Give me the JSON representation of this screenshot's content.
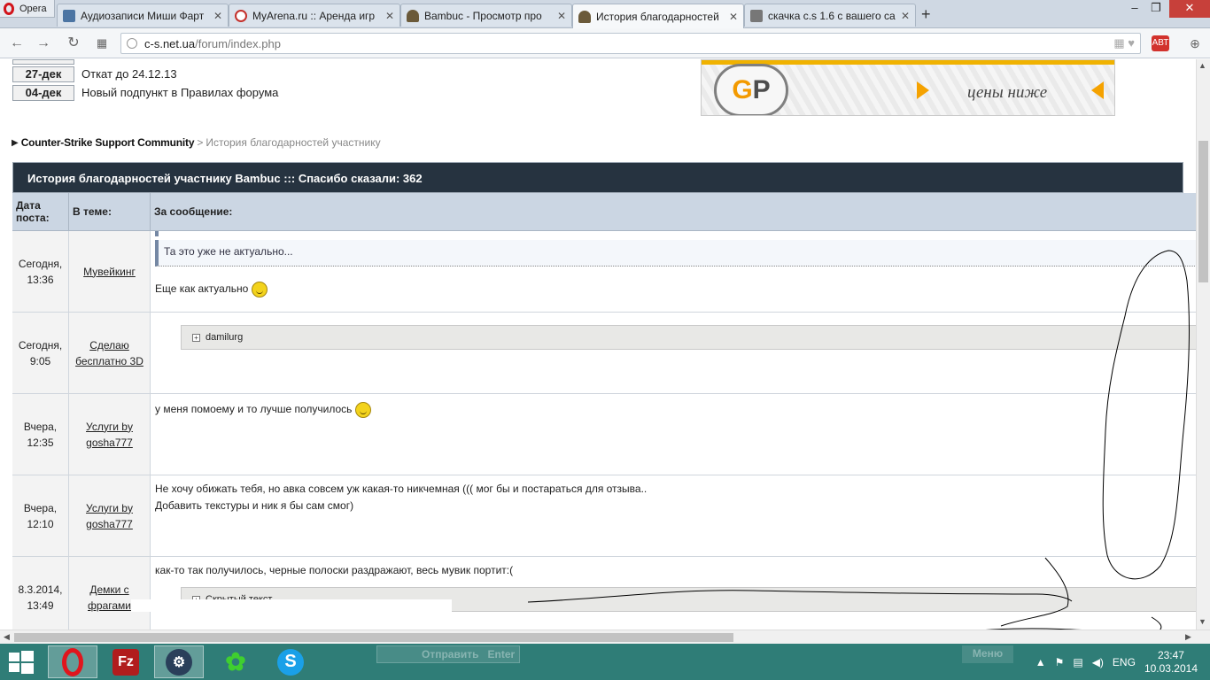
{
  "browser": {
    "menu_label": "Opera",
    "tabs": [
      {
        "title": "Аудиозаписи Миши Фарт",
        "icon": "vk-audio-icon",
        "color": "#4c75a3"
      },
      {
        "title": "MyArena.ru :: Аренда игр",
        "icon": "myarena-icon",
        "color": "#c4302b"
      },
      {
        "title": "Bambuc - Просмотр про",
        "icon": "cs-soldier-icon",
        "color": "#6b5a3a"
      },
      {
        "title": "История благодарностей",
        "icon": "cs-soldier-icon",
        "color": "#6b5a3a"
      },
      {
        "title": "скачка c.s 1.6 с вашего са",
        "icon": "gamepad-icon",
        "color": "#555555"
      }
    ],
    "address_host": "c-s.net.ua",
    "address_path": "/forum/index.php",
    "ext_badge": "АВТ"
  },
  "news": [
    {
      "date": "27-дек",
      "text": "Откат до 24.12.13"
    },
    {
      "date": "04-дек",
      "text": "Новый подпункт в Правилах форума"
    }
  ],
  "banner": {
    "logo_g": "G",
    "logo_p": "P",
    "text": "цены ниже",
    "accent": "#f5a200"
  },
  "breadcrumb": {
    "link": "Counter-Strike Support Community",
    "separator": ">",
    "current": "История благодарностей участнику"
  },
  "table": {
    "title": "История благодарностей участнику Bambuc ::: Спасибо сказали: 362",
    "col_date": "Дата поста:",
    "col_topic": "В теме:",
    "col_message": "За сообщение:",
    "rows": [
      {
        "date": "Сегодня, 13:36",
        "topic": "Мувейкинг",
        "quote": "Та это уже не актуально...",
        "message": "Еще как актуально"
      },
      {
        "date": "Сегодня, 9:05",
        "topic": "Сделаю бесплатно 3D",
        "spoiler": "damilurg"
      },
      {
        "date": "Вчера, 12:35",
        "topic": "Услуги by gosha777",
        "message": "у меня помоему и то лучше получилось"
      },
      {
        "date": "Вчера, 12:10",
        "topic": "Услуги by gosha777",
        "message": "Не хочу обижать тебя, но авка совсем уж какая-то никчемная ((( мог бы и постараться для отзыва..",
        "message2": "Добавить текстуры и ник я бы сам смог)"
      },
      {
        "date": "8.3.2014, 13:49",
        "topic": "Демки с фрагами",
        "message": "как-то так получилось, черные полоски раздражают, весь мувик портит:(",
        "spoiler": "Скрытый текст"
      }
    ]
  },
  "ghost": {
    "reply_label": "Отправить",
    "reply_hint": "Enter",
    "menu_label": "Меню"
  },
  "taskbar": {
    "apps": [
      "Opera",
      "FileZilla",
      "Steam",
      "ICQ",
      "Skype"
    ],
    "lang": "ENG",
    "time": "23:47",
    "date": "10.03.2014"
  }
}
